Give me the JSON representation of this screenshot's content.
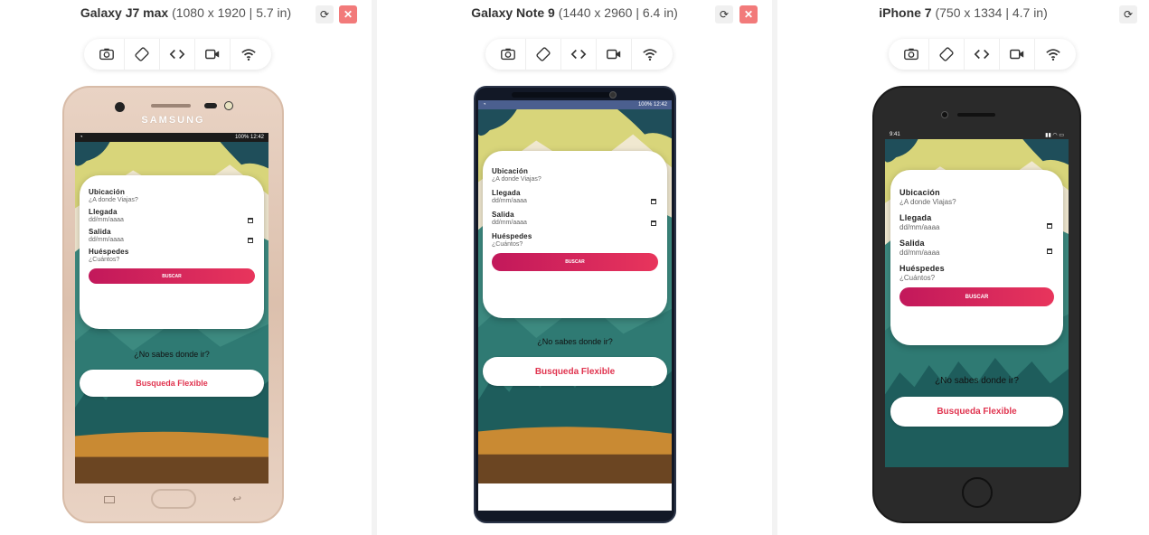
{
  "devices": [
    {
      "name": "Galaxy J7 max",
      "dims": "(1080 x 1920 | 5.7 in)",
      "brand": "SAMSUNG",
      "status": {
        "battery": "100%",
        "time": "12:42"
      }
    },
    {
      "name": "Galaxy Note 9",
      "dims": "(1440 x 2960 | 6.4 in)",
      "status": {
        "battery": "100%",
        "time": "12:42"
      }
    },
    {
      "name": "iPhone 7",
      "dims": "(750 x 1334 | 4.7 in)",
      "status": {
        "time": "9:41"
      }
    }
  ],
  "toolbar": [
    "camera-icon",
    "rotate-icon",
    "code-icon",
    "video-icon",
    "wifi-icon"
  ],
  "form": {
    "ubicacion_label": "Ubicación",
    "ubicacion_placeholder": "¿A donde Viajas?",
    "llegada_label": "Llegada",
    "llegada_value": "dd/mm/aaaa",
    "salida_label": "Salida",
    "salida_value": "dd/mm/aaaa",
    "huespedes_label": "Huéspedes",
    "huespedes_placeholder": "¿Cuántos?",
    "search_label": "BUSCAR"
  },
  "nosabes": "¿No sabes donde ir?",
  "flexible_label": "Busqueda Flexible",
  "colors": {
    "accent": "#e0344f",
    "button_gradient_start": "#c2185b",
    "sky": "#d9d77a",
    "forest": "#2f7a73",
    "ground": "#c98a33"
  }
}
